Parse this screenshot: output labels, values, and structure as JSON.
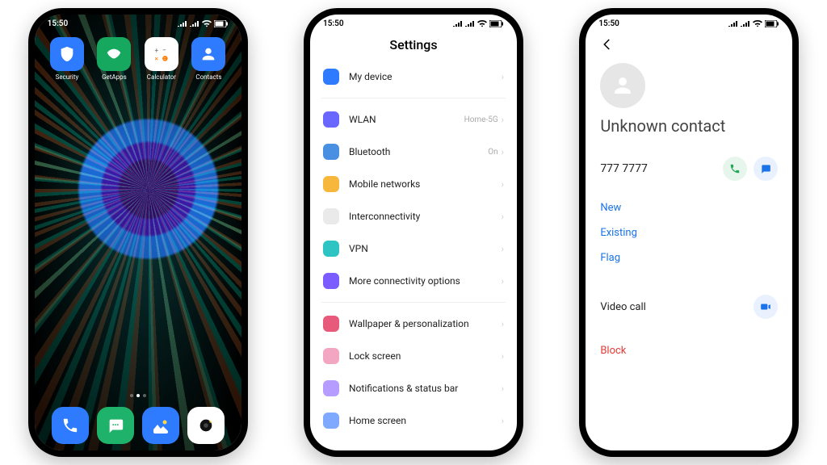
{
  "statusbar": {
    "time": "15:50"
  },
  "home": {
    "apps": [
      {
        "label": "Security",
        "name": "app-security",
        "bg": "#2f7bff",
        "fg": "#fff"
      },
      {
        "label": "GetApps",
        "name": "app-getapps",
        "bg": "#16a85f",
        "fg": "#fff"
      },
      {
        "label": "Calculator",
        "name": "app-calculator",
        "bg": "#ffffff",
        "fg": "#ff7a00"
      },
      {
        "label": "Contacts",
        "name": "app-contacts",
        "bg": "#2f7bff",
        "fg": "#fff"
      }
    ],
    "dock": [
      {
        "name": "dock-phone",
        "bg": "#2f7bff"
      },
      {
        "name": "dock-messages",
        "bg": "#1fb26a"
      },
      {
        "name": "dock-gallery",
        "bg": "#2f7bff"
      },
      {
        "name": "dock-camera",
        "bg": "#ffffff"
      }
    ]
  },
  "settings": {
    "title": "Settings",
    "groups": [
      [
        {
          "name": "my-device",
          "label": "My device",
          "value": "",
          "icon_bg": "#2f7bff"
        }
      ],
      [
        {
          "name": "wlan",
          "label": "WLAN",
          "value": "Home-5G",
          "icon_bg": "#6a67ff"
        },
        {
          "name": "bluetooth",
          "label": "Bluetooth",
          "value": "On",
          "icon_bg": "#4a90e2"
        },
        {
          "name": "mobile-networks",
          "label": "Mobile networks",
          "value": "",
          "icon_bg": "#f6b73c"
        },
        {
          "name": "interconnect",
          "label": "Interconnectivity",
          "value": "",
          "icon_bg": "#eaeaea"
        },
        {
          "name": "vpn",
          "label": "VPN",
          "value": "",
          "icon_bg": "#2ec4c4"
        },
        {
          "name": "more-conn",
          "label": "More connectivity options",
          "value": "",
          "icon_bg": "#7b5cff"
        }
      ],
      [
        {
          "name": "wallpaper",
          "label": "Wallpaper & personalization",
          "value": "",
          "icon_bg": "#e85a7a"
        },
        {
          "name": "lock-screen",
          "label": "Lock screen",
          "value": "",
          "icon_bg": "#f2a6c2"
        },
        {
          "name": "notifications",
          "label": "Notifications & status bar",
          "value": "",
          "icon_bg": "#b79cff"
        },
        {
          "name": "home-screen",
          "label": "Home screen",
          "value": "",
          "icon_bg": "#7fa8ff"
        }
      ]
    ]
  },
  "contact": {
    "name": "Unknown contact",
    "number": "777 7777",
    "links": [
      {
        "name": "link-new",
        "label": "New"
      },
      {
        "name": "link-existing",
        "label": "Existing"
      },
      {
        "name": "link-flag",
        "label": "Flag"
      }
    ],
    "video_call": "Video call",
    "block": "Block"
  }
}
